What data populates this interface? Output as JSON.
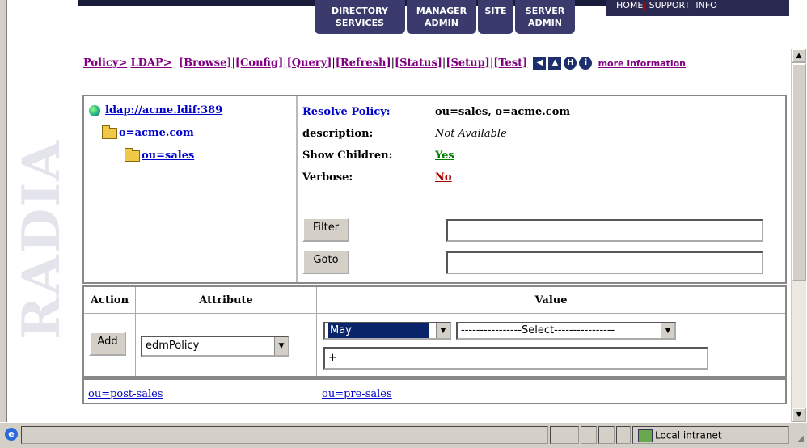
{
  "nav": {
    "tabs": [
      {
        "line1": "DIRECTORY",
        "line2": "SERVICES"
      },
      {
        "line1": "MANAGER",
        "line2": "ADMIN"
      },
      {
        "line1": "SITE",
        "line2": ""
      },
      {
        "line1": "SERVER",
        "line2": "ADMIN"
      }
    ],
    "utility": {
      "home": "HOME",
      "support": "SUPPORT",
      "info": "INFO"
    }
  },
  "watermark": "RADIA",
  "breadcrumb": {
    "policy": "Policy>",
    "ldap": "LDAP>",
    "links": [
      "[Browse]",
      "[Config]",
      "[Query]",
      "[Refresh]",
      "[Status]",
      "[Setup]",
      "[Test]"
    ],
    "more_info": "more information"
  },
  "tree": {
    "root": "ldap://acme.ldif:389",
    "level1": "o=acme.com",
    "level2": "ou=sales"
  },
  "details": {
    "resolve_label": "Resolve Policy:",
    "resolve_value": "ou=sales, o=acme.com",
    "description_label": "description:",
    "description_value": "Not Available",
    "children_label": "Show Children:",
    "children_value": "Yes",
    "verbose_label": "Verbose:",
    "verbose_value": "No",
    "filter_button": "Filter",
    "goto_button": "Goto"
  },
  "attr_table": {
    "col_action": "Action",
    "col_attribute": "Attribute",
    "col_value": "Value",
    "add_button": "Add",
    "attribute_selected": "edmPolicy",
    "month_selected": "May",
    "select_placeholder": "----------------Select----------------",
    "value_input": "+"
  },
  "child_links": [
    "ou=post-sales",
    "ou=pre-sales"
  ],
  "statusbar": {
    "zone": "Local intranet"
  },
  "colors": {
    "nav": "#3a3a6c",
    "link": "#0000cc",
    "visited": "#800080",
    "yes": "#008000",
    "no": "#aa0000"
  }
}
